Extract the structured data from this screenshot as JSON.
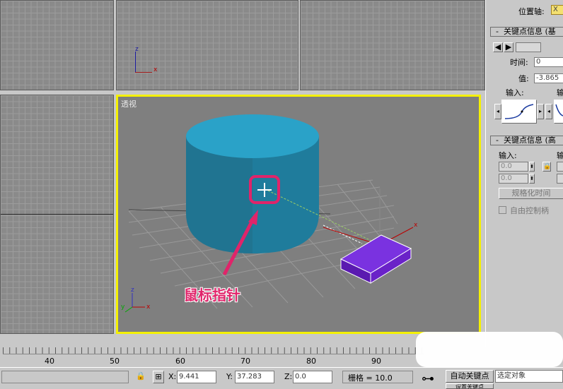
{
  "viewports": {
    "perspective_label": "透视",
    "annotation": "鼠标指针"
  },
  "axes": {
    "x": "x",
    "y": "y",
    "z": "z"
  },
  "right_panel": {
    "pos_axis_label": "位置轴:",
    "pos_axis_value": "X",
    "rollout1_title": "关键点信息 (基",
    "rollout1_minus": "-",
    "time_label": "时间:",
    "time_value": "0",
    "value_label": "值:",
    "value_value": "-3.865",
    "input_label": "输入:",
    "output_label_partial": "输",
    "rollout2_title": "关键点信息 (高",
    "rollout2_minus": "-",
    "input2_label": "输入:",
    "output2_label_partial": "输",
    "in_val1": "0.0",
    "in_val2": "0.0",
    "normalize_btn": "规格化时间",
    "free_handle": "自由控制柄"
  },
  "timeline": {
    "ticks": [
      "40",
      "50",
      "60",
      "70",
      "80",
      "90"
    ]
  },
  "status": {
    "x_label": "X:",
    "x_value": "9.441",
    "y_label": "Y:",
    "y_value": "37.283",
    "z_label": "Z:",
    "z_value": "0.0",
    "grid_text": "栅格 = 10.0",
    "auto_key": "自动关键点",
    "selection": "选定对象",
    "set_key_partial": "设置关键点"
  }
}
